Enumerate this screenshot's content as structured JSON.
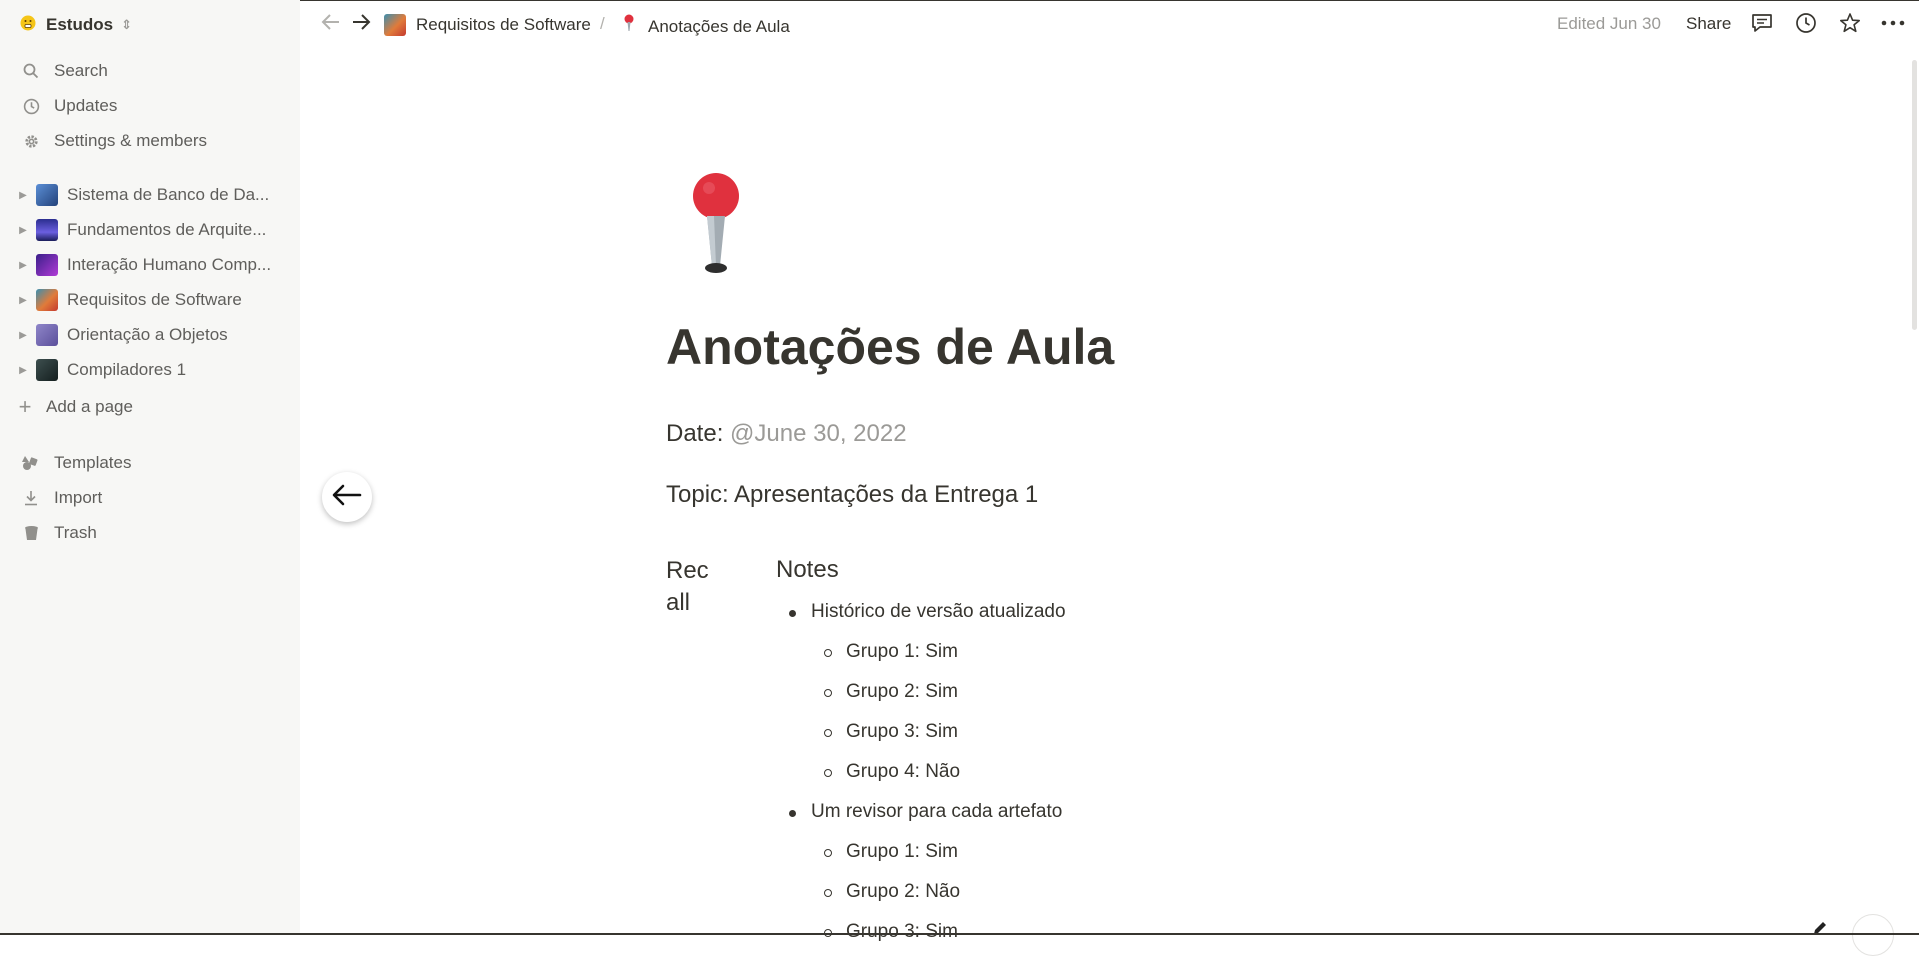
{
  "workspace": {
    "name": "Estudos",
    "icon": "emoji-icon"
  },
  "sidebar": {
    "nav": [
      {
        "label": "Search",
        "icon": "search-icon"
      },
      {
        "label": "Updates",
        "icon": "clock-icon"
      },
      {
        "label": "Settings & members",
        "icon": "gear-icon"
      }
    ],
    "pages": [
      {
        "label": "Sistema de Banco de Da...",
        "color": "#3a6ea5"
      },
      {
        "label": "Fundamentos de Arquite...",
        "color": "#4a3fb0"
      },
      {
        "label": "Interação Humano Comp...",
        "color": "#6a2fa8"
      },
      {
        "label": "Requisitos de Software",
        "color": "#d2693a"
      },
      {
        "label": "Orientação a Objetos",
        "color": "#7a6fb5"
      },
      {
        "label": "Compiladores 1",
        "color": "#2b3a3a"
      }
    ],
    "add_page": "Add a page",
    "footer": [
      {
        "label": "Templates",
        "icon": "templates-icon"
      },
      {
        "label": "Import",
        "icon": "download-icon"
      },
      {
        "label": "Trash",
        "icon": "trash-icon"
      }
    ]
  },
  "topbar": {
    "breadcrumb": [
      {
        "label": "Requisitos de Software"
      },
      {
        "label": "Anotações de Aula"
      }
    ],
    "separator": "/",
    "edited": "Edited Jun 30",
    "share": "Share"
  },
  "page": {
    "icon": "pushpin-icon",
    "title": "Anotações de Aula",
    "date_label": "Date:",
    "date_value": "@June 30, 2022",
    "topic": "Topic: Apresentações da Entrega 1",
    "recall": "Rec all",
    "notes_heading": "Notes",
    "items": [
      {
        "text": "Histórico de versão atualizado",
        "level": 1
      },
      {
        "text": "Grupo 1: Sim",
        "level": 2
      },
      {
        "text": "Grupo 2: Sim",
        "level": 2
      },
      {
        "text": "Grupo 3: Sim",
        "level": 2
      },
      {
        "text": "Grupo 4: Não",
        "level": 2
      },
      {
        "text": "Um revisor para cada artefato",
        "level": 1
      },
      {
        "text": "Grupo 1: Sim",
        "level": 2
      },
      {
        "text": "Grupo 2: Não",
        "level": 2
      },
      {
        "text": "Grupo 3: Sim",
        "level": 2
      }
    ]
  },
  "colors": {
    "accent_pin": "#e0313e",
    "sidebar_bg": "#f7f7f5",
    "text": "#37352f",
    "muted": "#9b9a97"
  }
}
